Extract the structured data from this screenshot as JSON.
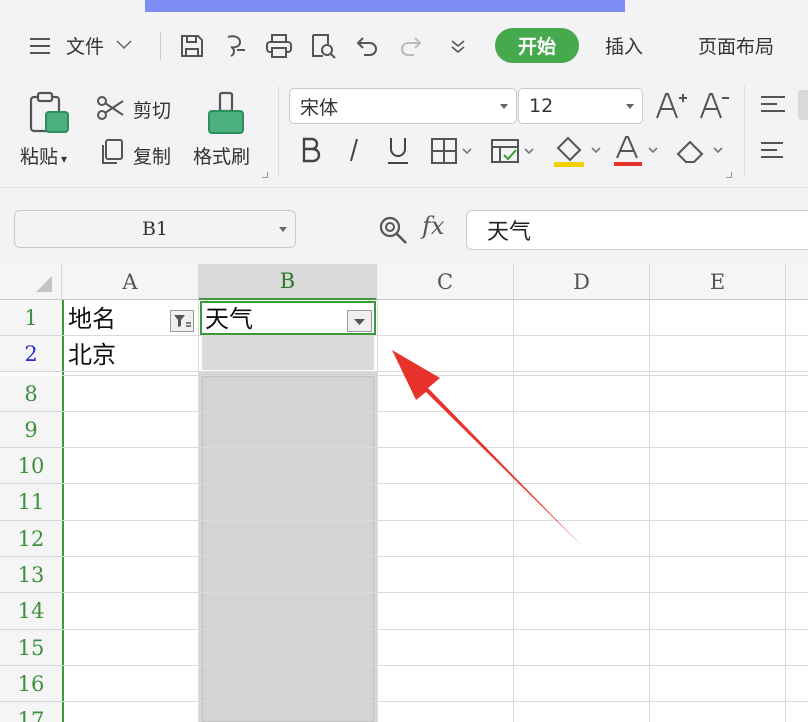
{
  "menu": {
    "file_label": "文件",
    "items": [
      "开始",
      "插入",
      "页面布局"
    ]
  },
  "ribbon": {
    "paste_label": "粘贴",
    "cut_label": "剪切",
    "copy_label": "复制",
    "format_painter_label": "格式刷",
    "font_name": "宋体",
    "font_size": "12"
  },
  "formula_bar": {
    "cell_ref": "B1",
    "fx_label": "fx",
    "value": "天气"
  },
  "sheet": {
    "columns": [
      "A",
      "B",
      "C",
      "D",
      "E"
    ],
    "rows": [
      "1",
      "2",
      "8",
      "9",
      "10",
      "11",
      "12",
      "13",
      "14",
      "15",
      "16",
      "17"
    ],
    "cells": {
      "A1": "地名",
      "B1": "天气",
      "A2": "北京"
    }
  },
  "colors": {
    "accent_green": "#47a94d",
    "selection_green": "#3a9a3a",
    "arrow_red": "#e8322c",
    "filtered_row_blue": "#2b2bd0"
  }
}
